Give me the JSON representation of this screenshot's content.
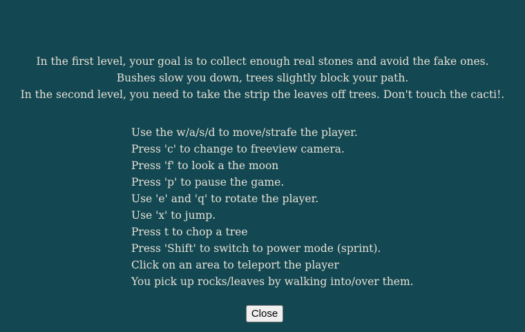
{
  "intro": {
    "lines": [
      "In the first level, your goal is to collect enough real stones and avoid the fake ones.",
      "Bushes slow you down, trees slightly block your path.",
      "In the second level, you need to take the strip the leaves off trees. Don't touch the cacti!."
    ]
  },
  "controls": {
    "lines": [
      "Use the w/a/s/d to move/strafe the player.",
      "Press 'c' to change to freeview camera.",
      "Press 'f' to look a the moon",
      "Press 'p' to pause the game.",
      "Use 'e' and 'q' to rotate the player.",
      "Use 'x' to jump.",
      "Press t to chop a tree",
      "Press 'Shift' to switch to power mode (sprint).",
      "Click on an area to teleport the player",
      "You pick up rocks/leaves by walking into/over them."
    ]
  },
  "close_button": {
    "label": "Close"
  },
  "colors": {
    "background": "#134752",
    "text": "#e6e2d6"
  }
}
